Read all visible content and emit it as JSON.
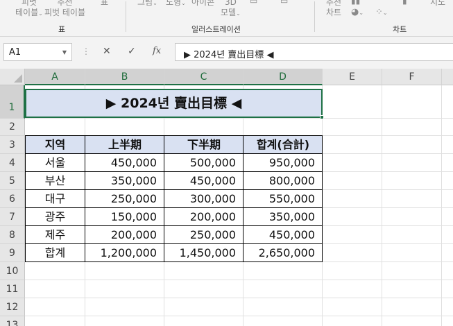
{
  "ribbon": {
    "items": [
      {
        "line1": "피벗",
        "line2": "테이블"
      },
      {
        "line1": "추천",
        "line2": "피벗 테이블"
      },
      {
        "line1": "표",
        "line2": ""
      },
      {
        "line1": "그림",
        "line2": ""
      },
      {
        "line1": "도형",
        "line2": ""
      },
      {
        "line1": "아이콘",
        "line2": ""
      },
      {
        "line1": "3D",
        "line2": "모델"
      },
      {
        "line1": "추천",
        "line2": "차트"
      },
      {
        "line1": "지도",
        "line2": ""
      }
    ],
    "groups": {
      "table": "표",
      "illustrations": "일러스트레이션",
      "charts": "차트"
    }
  },
  "formula_bar": {
    "name_box": "A1",
    "cancel_symbol": "✕",
    "enter_symbol": "✓",
    "fx_label": "fx",
    "formula": "▶ 2024년 賣出目標 ◀"
  },
  "columns": [
    "A",
    "B",
    "C",
    "D",
    "E",
    "F"
  ],
  "rows": [
    "1",
    "2",
    "3",
    "4",
    "5",
    "6",
    "7",
    "8",
    "9",
    "10",
    "11",
    "12",
    "13"
  ],
  "sheet": {
    "title": "▶ 2024년 賣出目標 ◀",
    "headers": [
      "지역",
      "上半期",
      "下半期",
      "합계(合計)"
    ],
    "data": [
      [
        "서울",
        "450,000",
        "500,000",
        "950,000"
      ],
      [
        "부산",
        "350,000",
        "450,000",
        "800,000"
      ],
      [
        "대구",
        "250,000",
        "300,000",
        "550,000"
      ],
      [
        "광주",
        "150,000",
        "200,000",
        "350,000"
      ],
      [
        "제주",
        "200,000",
        "250,000",
        "450,000"
      ],
      [
        "합계",
        "1,200,000",
        "1,450,000",
        "2,650,000"
      ]
    ]
  },
  "colors": {
    "accent": "#1e7145",
    "header_fill": "#d9e1f2"
  }
}
